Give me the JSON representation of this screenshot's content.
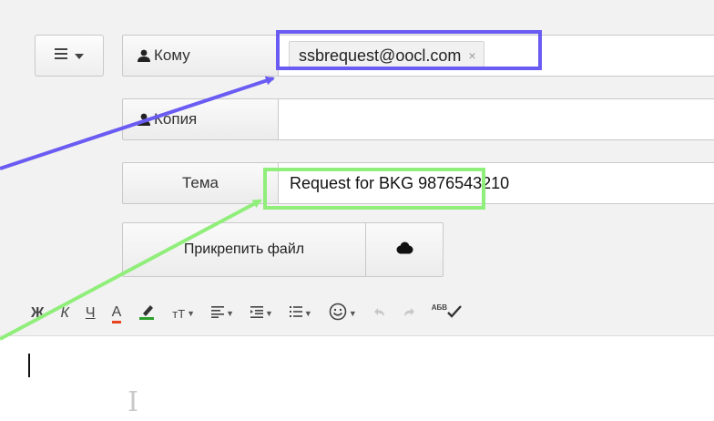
{
  "compose": {
    "to": {
      "label": "Кому",
      "recipient": "ssbrequest@oocl.com",
      "remove": "×"
    },
    "cc": {
      "label": "Копия",
      "value": ""
    },
    "subject": {
      "label": "Тема",
      "value": "Request for BKG 9876543210"
    },
    "attach_label": "Прикрепить файл"
  },
  "toolbar": {
    "bold": "Ж",
    "italic": "К",
    "underline": "Ч",
    "text_color": "А",
    "font_size": "тТ",
    "spellcheck": "АБВ"
  },
  "icons": {
    "menu": "hamburger-icon",
    "person": "person-icon",
    "cloud": "cloud-icon"
  },
  "colors": {
    "highlight_blue": "#6a5cf2",
    "highlight_green": "#90ee7a",
    "text_color_red": "#e8431f",
    "highlight_color_green": "#2ca02c"
  }
}
